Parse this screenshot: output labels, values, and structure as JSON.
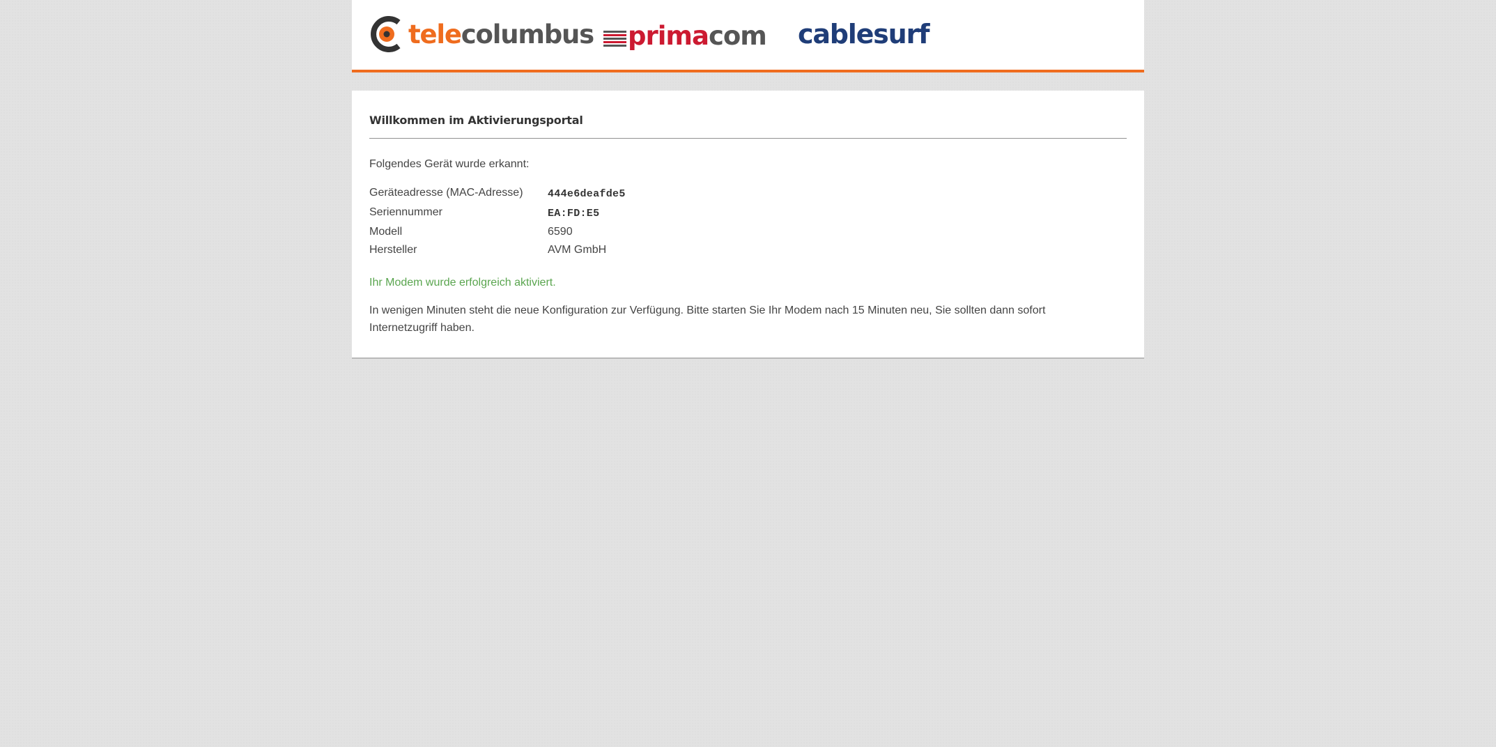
{
  "header": {
    "logos": {
      "telecolumbus": {
        "part1": "tele",
        "part2": "columbus"
      },
      "primacom": {
        "part1": "prima",
        "part2": "com"
      },
      "cablesurf": {
        "text": "cablesurf"
      }
    },
    "accent_color": "#ef6c1e"
  },
  "main": {
    "title": "Willkommen im Aktivierungsportal",
    "intro": "Folgendes Gerät wurde erkannt:",
    "device": [
      {
        "label": "Geräteadresse (MAC-Adresse)",
        "value": "444e6deafde5"
      },
      {
        "label": "Seriennummer",
        "value": "EA:FD:E5"
      },
      {
        "label": "Modell",
        "value": "6590"
      },
      {
        "label": "Hersteller",
        "value": "AVM GmbH"
      }
    ],
    "success_message": "Ihr Modem wurde erfolgreich aktiviert.",
    "success_color": "#5aa54f",
    "note": "In wenigen Minuten steht die neue Konfiguration zur Verfügung. Bitte starten Sie Ihr Modem nach 15 Minuten neu, Sie sollten dann sofort Internetzugriff haben."
  }
}
